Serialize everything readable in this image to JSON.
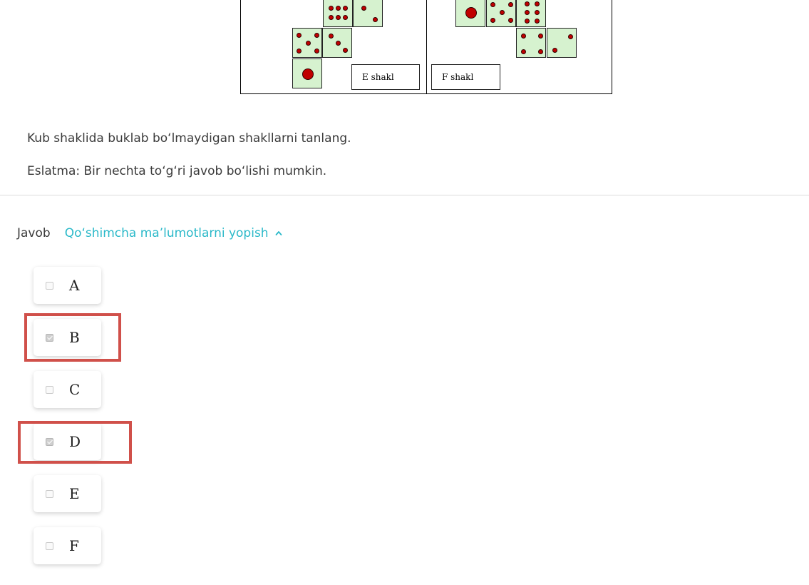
{
  "figure": {
    "label_e": "E shakl",
    "label_f": "F shakl",
    "face_color": "#d6f2cf",
    "pip_color": "#c00000"
  },
  "question": {
    "text": "Kub shaklida buklab bo‘lmaydigan shakllarni tanlang.",
    "note": "Eslatma: Bir nechta to‘g‘ri javob bo‘lishi mumkin."
  },
  "answer": {
    "label": "Javob",
    "toggle_link": "Qo‘shimcha ma’lumotlarni yopish",
    "toggle_icon": "chevron-up-icon",
    "link_color": "#2bb9c9",
    "highlight_color": "#d0504a",
    "options": [
      {
        "letter": "A",
        "checked": false,
        "highlighted": false
      },
      {
        "letter": "B",
        "checked": true,
        "highlighted": true
      },
      {
        "letter": "C",
        "checked": false,
        "highlighted": false
      },
      {
        "letter": "D",
        "checked": true,
        "highlighted": true
      },
      {
        "letter": "E",
        "checked": false,
        "highlighted": false
      },
      {
        "letter": "F",
        "checked": false,
        "highlighted": false
      }
    ]
  }
}
